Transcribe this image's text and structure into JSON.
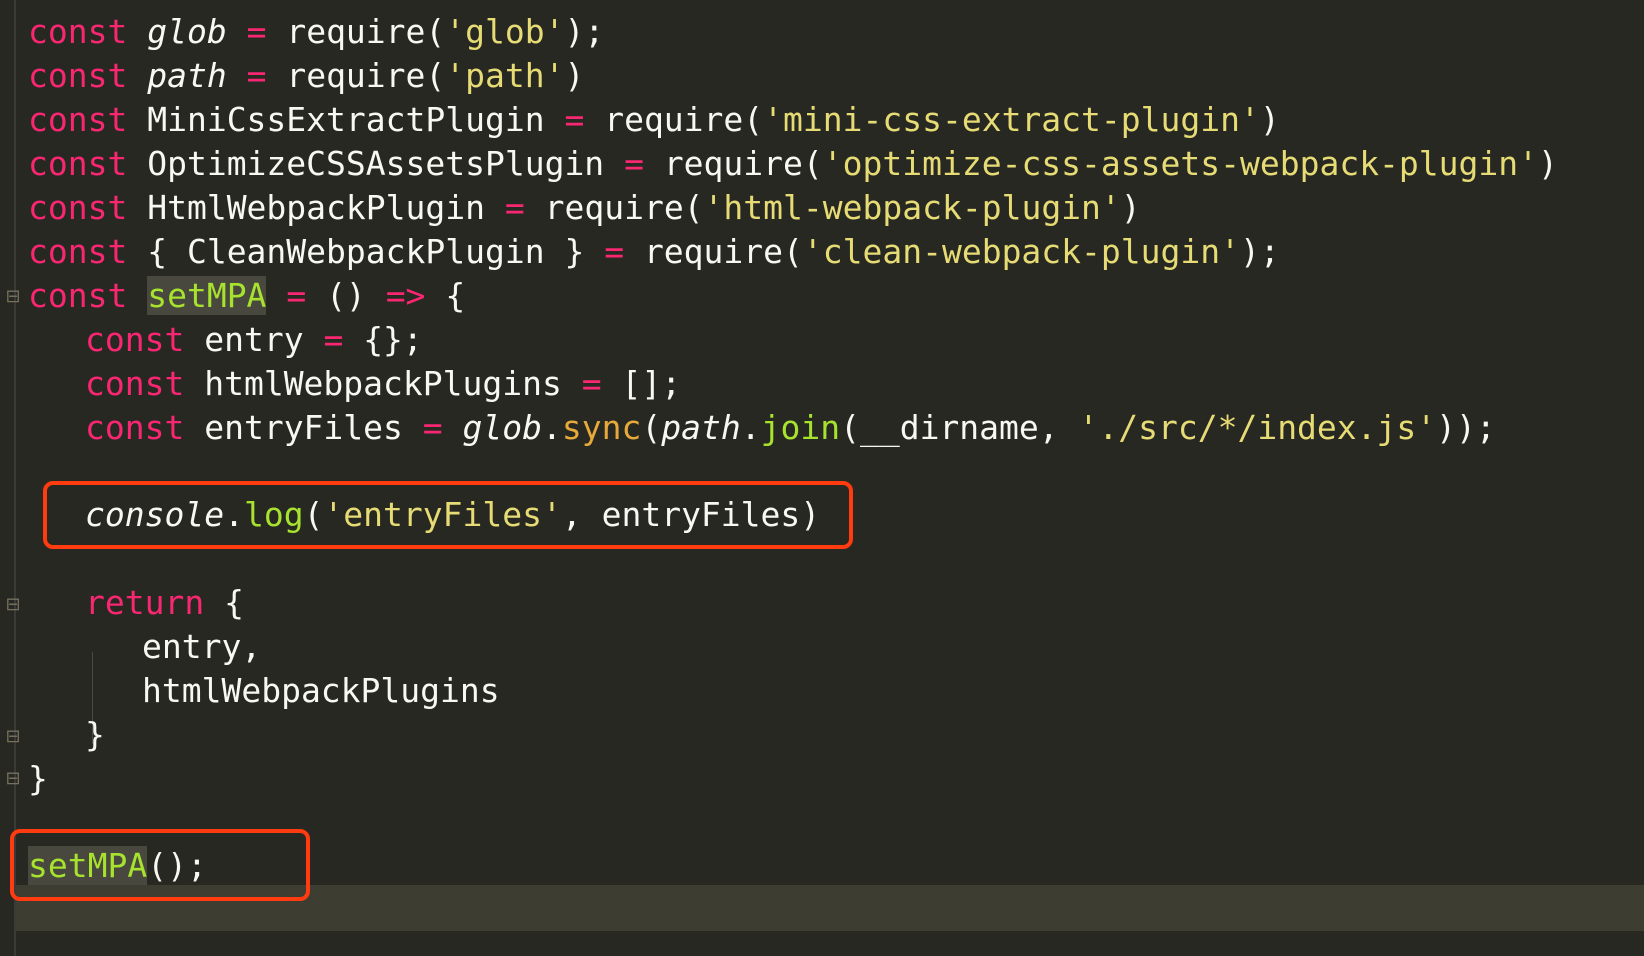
{
  "editor": {
    "lines": {
      "l1": {
        "kw": "const",
        "name": "glob",
        "eq": "=",
        "req": "require(",
        "str": "'glob'",
        "end": ");"
      },
      "l2": {
        "kw": "const",
        "name": "path",
        "eq": "=",
        "req": "require(",
        "str": "'path'",
        "end": ")"
      },
      "l3": {
        "kw": "const",
        "name": "MiniCssExtractPlugin",
        "eq": "=",
        "req": "require(",
        "str": "'mini-css-extract-plugin'",
        "end": ")"
      },
      "l4": {
        "kw": "const",
        "name": "OptimizeCSSAssetsPlugin",
        "eq": "=",
        "req": "require(",
        "str": "'optimize-css-assets-webpack-plugin'",
        "end": ")"
      },
      "l5": {
        "kw": "const",
        "name": "HtmlWebpackPlugin",
        "eq": "=",
        "req": "require(",
        "str": "'html-webpack-plugin'",
        "end": ")"
      },
      "l6": {
        "kw": "const",
        "name": "{ CleanWebpackPlugin }",
        "eq": "=",
        "req": "require(",
        "str": "'clean-webpack-plugin'",
        "end": ");"
      },
      "l7": {
        "kw": "const",
        "name": "setMPA",
        "eq": "=",
        "args": "()",
        "arrow": "=>",
        "brace": "{"
      },
      "l8": {
        "kw": "const",
        "name": "entry",
        "eq": "=",
        "rest": "{};"
      },
      "l9": {
        "kw": "const",
        "name": "htmlWebpackPlugins",
        "eq": "=",
        "rest": "[];"
      },
      "l10": {
        "kw": "const",
        "name": "entryFiles",
        "eq": "=",
        "obj": "glob",
        "dot1": ".",
        "method": "sync",
        "paren1": "(",
        "obj2": "path",
        "dot2": ".",
        "method2": "join",
        "args": "(__dirname, ",
        "str": "'./src/*/index.js'",
        "end": "));"
      },
      "l12": {
        "obj": "console",
        "dot": ".",
        "method": "log",
        "open": "(",
        "str": "'entryFiles'",
        "rest": ", entryFiles)"
      },
      "l14": {
        "kw": "return",
        "brace": "{"
      },
      "l15": {
        "text": "entry,"
      },
      "l16": {
        "text": "htmlWebpackPlugins"
      },
      "l17": {
        "text": "}"
      },
      "l18": {
        "text": "}"
      },
      "l20": {
        "name": "setMPA",
        "rest": "();"
      }
    },
    "colors": {
      "background": "#272822",
      "keyword": "#f92672",
      "string": "#e6db74",
      "function": "#a6e22e",
      "annotation_box": "#ff3b0f"
    },
    "icons": [
      "fold-open-icon",
      "fold-close-icon"
    ]
  }
}
